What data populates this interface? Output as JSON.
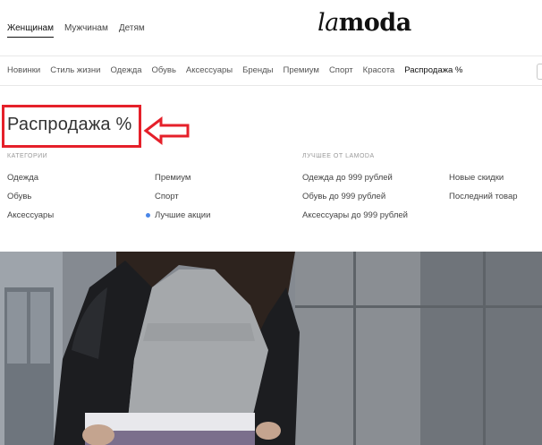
{
  "header": {
    "gender_tabs": [
      "Женщинам",
      "Мужчинам",
      "Детям"
    ],
    "logo_la": "la",
    "logo_moda": "moda"
  },
  "nav": {
    "items": [
      "Новинки",
      "Стиль жизни",
      "Одежда",
      "Обувь",
      "Аксессуары",
      "Бренды",
      "Премиум",
      "Спорт",
      "Красота",
      "Распродажа %"
    ]
  },
  "menu": {
    "title": "Распродажа %",
    "categories_header": "КАТЕГОРИИ",
    "best_header": "ЛУЧШЕЕ ОТ LAMODA",
    "col1": [
      "Одежда",
      "Обувь",
      "Аксессуары"
    ],
    "col2": [
      "Премиум",
      "Спорт",
      "Лучшие акции"
    ],
    "col3": [
      "Одежда до 999 рублей",
      "Обувь до 999 рублей",
      "Аксессуары до 999 рублей"
    ],
    "col4": [
      "Новые скидки",
      "Последний товар"
    ]
  },
  "colors": {
    "annotation_red": "#e5202a",
    "dot_blue": "#4a86e8"
  },
  "icons": {
    "annotation": "left-arrow-icon"
  }
}
